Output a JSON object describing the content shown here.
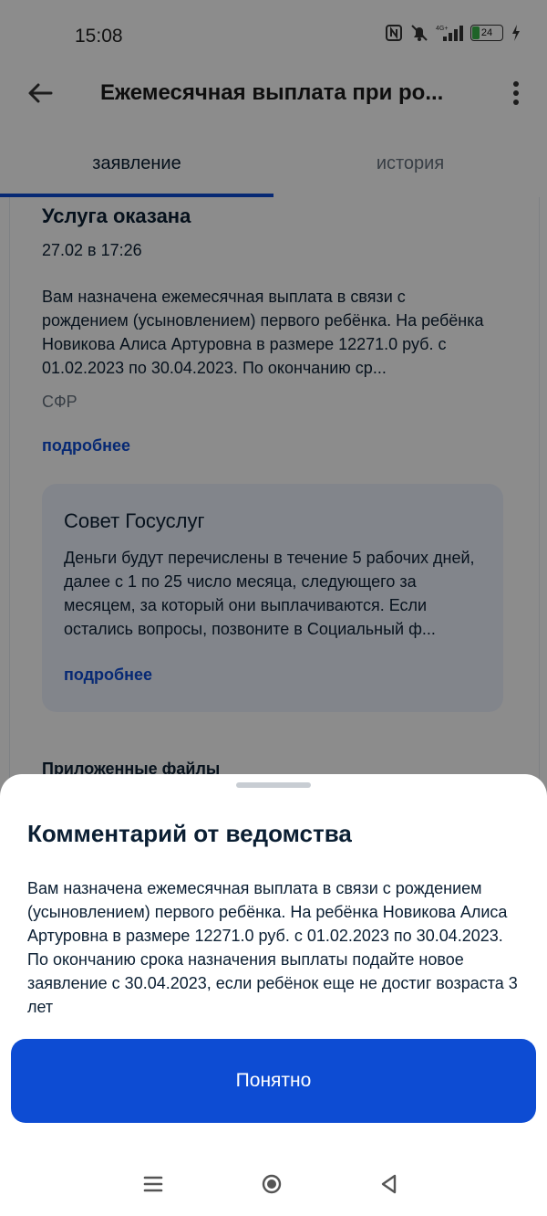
{
  "status_bar": {
    "time": "15:08",
    "battery": "24"
  },
  "app_bar": {
    "title": "Ежемесячная выплата при ро..."
  },
  "tabs": [
    {
      "label": "заявление",
      "active": true
    },
    {
      "label": "история",
      "active": false
    }
  ],
  "application": {
    "status_title": "Услуга оказана",
    "date": "27.02 в 17:26",
    "description": "Вам назначена ежемесячная выплата в связи с рождением (усыновлением) первого ребёнка. На ребёнка Новикова Алиса Артуровна в размере 12271.0 руб. с 01.02.2023 по 30.04.2023. По окончанию ср...",
    "source": "СФР",
    "more_link": "подробнее",
    "tip": {
      "title": "Совет Госуслуг",
      "text": "Деньги будут перечислены в течение 5 рабочих дней, далее с 1 по 25 число месяца, следующего за месяцем, за который они выплачиваются. Если остались вопросы, позвоните в Социальный ф...",
      "more_link": "подробнее"
    },
    "files_title": "Приложенные файлы"
  },
  "sheet": {
    "title": "Комментарий от ведомства",
    "text": "Вам назначена ежемесячная выплата в связи с рождением (усыновлением) первого ребёнка. На ребёнка Новикова Алиса Артуровна в размере 12271.0 руб. с 01.02.2023 по 30.04.2023. По окончанию срока назначения выплаты подайте новое заявление с 30.04.2023, если ребёнок еще не достиг возраста 3 лет",
    "button_label": "Понятно"
  },
  "colors": {
    "accent": "#0d4cd3",
    "tip_background": "#edf2fe"
  }
}
